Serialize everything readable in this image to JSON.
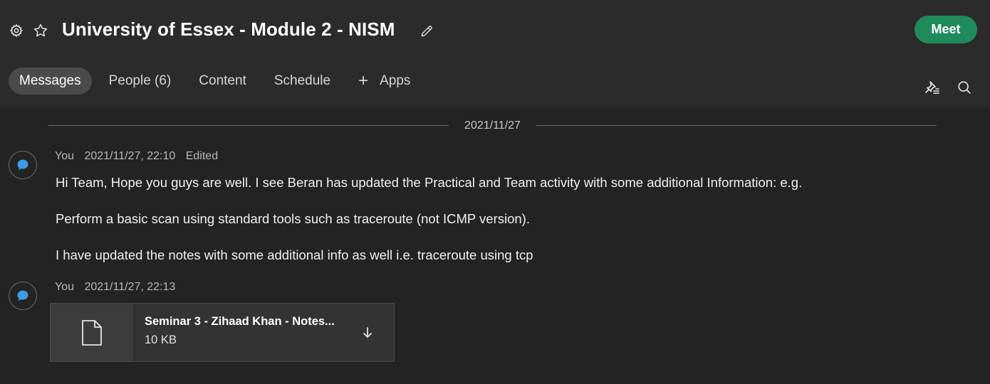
{
  "header": {
    "title": "University of Essex - Module 2 - NISM",
    "meet_label": "Meet"
  },
  "tabs": [
    {
      "label": "Messages",
      "active": true
    },
    {
      "label": "People (6)",
      "active": false
    },
    {
      "label": "Content",
      "active": false
    },
    {
      "label": "Schedule",
      "active": false
    },
    {
      "label": "Apps",
      "active": false
    }
  ],
  "icons": {
    "settings": "gear-icon",
    "favorite": "star-icon",
    "edit": "pencil-icon",
    "add_app": "plus-icon",
    "pinned": "pin-icon",
    "search": "search-icon",
    "avatar": "chat-bubble-icon",
    "file": "document-icon",
    "download": "download-arrow-icon"
  },
  "colors": {
    "background": "#232323",
    "header_background": "#2b2b2b",
    "meet_button": "#1f8a5b",
    "active_tab": "#4a4a4a",
    "avatar_accent": "#3d9be9"
  },
  "timeline": {
    "date_divider": "2021/11/27",
    "messages": [
      {
        "author": "You",
        "timestamp": "2021/11/27, 22:10",
        "edited": "Edited",
        "lines": [
          "Hi Team, Hope you guys are well. I see Beran has updated the Practical and Team activity with some additional Information: e.g.",
          "Perform a basic scan using standard tools such as traceroute (not ICMP version).",
          "I have updated the notes with some additional info as well i.e. traceroute using tcp"
        ]
      },
      {
        "author": "You",
        "timestamp": "2021/11/27, 22:13",
        "attachment": {
          "name": "Seminar 3 - Zihaad Khan - Notes...",
          "size": "10 KB"
        }
      }
    ]
  }
}
